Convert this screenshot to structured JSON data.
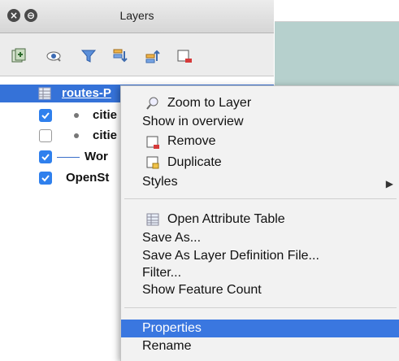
{
  "panel": {
    "title": "Layers",
    "titlebar_buttons": [
      "close-icon",
      "float-icon"
    ],
    "toolbar": [
      "add-group-icon",
      "visibility-icon",
      "filter-icon",
      "expand-all-icon",
      "collapse-all-icon",
      "remove-layer-icon"
    ]
  },
  "layers": [
    {
      "name": "routes-P",
      "checked": null,
      "selected": true
    },
    {
      "name": "citie",
      "checked": true,
      "symbol": "point"
    },
    {
      "name": "citie",
      "checked": false,
      "symbol": "point"
    },
    {
      "name": "Wor",
      "checked": true,
      "symbol": "line"
    },
    {
      "name": "OpenSt",
      "checked": true,
      "symbol": "none"
    }
  ],
  "menu": {
    "zoom": "Zoom to Layer",
    "overview": "Show in overview",
    "remove": "Remove",
    "duplicate": "Duplicate",
    "styles": "Styles",
    "styles_arrow": "▶",
    "attr_table": "Open Attribute Table",
    "save_as": "Save As...",
    "save_def": "Save As Layer Definition File...",
    "filter": "Filter...",
    "feature_count": "Show Feature Count",
    "properties": "Properties",
    "rename": "Rename",
    "highlighted": "Properties"
  },
  "colors": {
    "selection": "#3572d8",
    "checkbox": "#2f80ed",
    "map_bg": "#b6d0cd"
  }
}
